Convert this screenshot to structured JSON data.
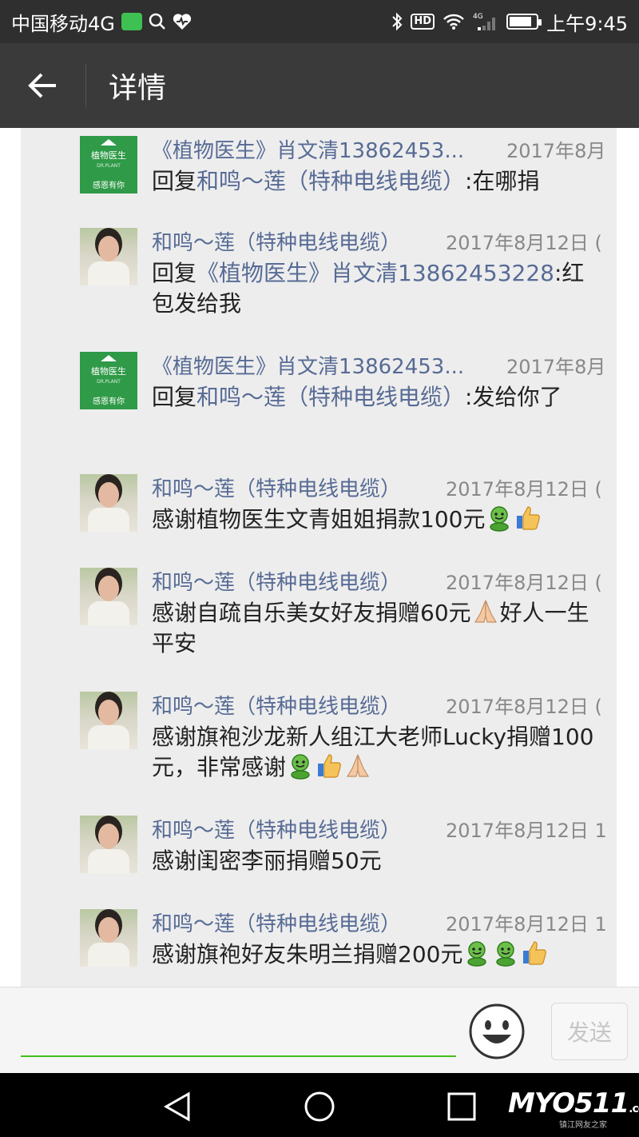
{
  "status_bar": {
    "carrier": "中国移动4G",
    "hd": "HD",
    "network": "4G",
    "battery_level": 0.85,
    "time": "上午9:45"
  },
  "header": {
    "back_icon": "arrow-left-icon",
    "title": "详情"
  },
  "comments": [
    {
      "avatar": "plant",
      "avatar_text": [
        "植物医生",
        "DR.PLANT",
        "感恩有你"
      ],
      "name": "《植物医生》肖文清13862453...",
      "time": "2017年8月",
      "reply_prefix": "回复",
      "reply_to": "和鸣～莲（特种电线电缆）",
      "body": ":在哪捐"
    },
    {
      "avatar": "person",
      "name": "和鸣～莲（特种电线电缆）",
      "time": "2017年8月12日 (",
      "reply_prefix": "回复",
      "reply_to": "《植物医生》肖文清13862453228",
      "body": ":红包发给我"
    },
    {
      "avatar": "plant",
      "avatar_text": [
        "植物医生",
        "DR.PLANT",
        "感恩有你"
      ],
      "name": "《植物医生》肖文清13862453...",
      "time": "2017年8月",
      "reply_prefix": "回复",
      "reply_to": "和鸣～莲（特种电线电缆）",
      "body": ":发给你了"
    },
    {
      "avatar": "person",
      "name": "和鸣～莲（特种电线电缆）",
      "time": "2017年8月12日 (",
      "body": "感谢植物医生文青姐姐捐款100元",
      "emojis": [
        "green-face",
        "thumbs-up"
      ]
    },
    {
      "avatar": "person",
      "name": "和鸣～莲（特种电线电缆）",
      "time": "2017年8月12日 (",
      "body": "感谢自疏自乐美女好友捐赠60元",
      "emojis": [
        "praying-hands"
      ],
      "body_after": "好人一生平安"
    },
    {
      "avatar": "person",
      "name": "和鸣～莲（特种电线电缆）",
      "time": "2017年8月12日 (",
      "body": "感谢旗袍沙龙新人组江大老师Lucky捐赠100元，非常感谢",
      "emojis": [
        "green-face",
        "thumbs-up",
        "praying-hands"
      ]
    },
    {
      "avatar": "person",
      "name": "和鸣～莲（特种电线电缆）",
      "time": "2017年8月12日 1",
      "body": "感谢闺密李丽捐赠50元"
    },
    {
      "avatar": "person",
      "name": "和鸣～莲（特种电线电缆）",
      "time": "2017年8月12日 1",
      "body": "感谢旗袍好友朱明兰捐赠200元",
      "emojis": [
        "green-face",
        "green-face",
        "thumbs-up"
      ]
    }
  ],
  "input_bar": {
    "emoji_icon": "smiley-icon",
    "send_label": "发送"
  },
  "nav_bar": {
    "back_icon": "triangle-back-icon",
    "home_icon": "circle-home-icon",
    "recents_icon": "square-recents-icon"
  },
  "watermark": {
    "logo_text": "MYO511",
    "domain_text": ".com",
    "sub_text": "镇江网友之家"
  },
  "colors": {
    "name_link": "#576b95",
    "accent_green": "#45c01a",
    "header_bg": "#3a3a3a"
  }
}
